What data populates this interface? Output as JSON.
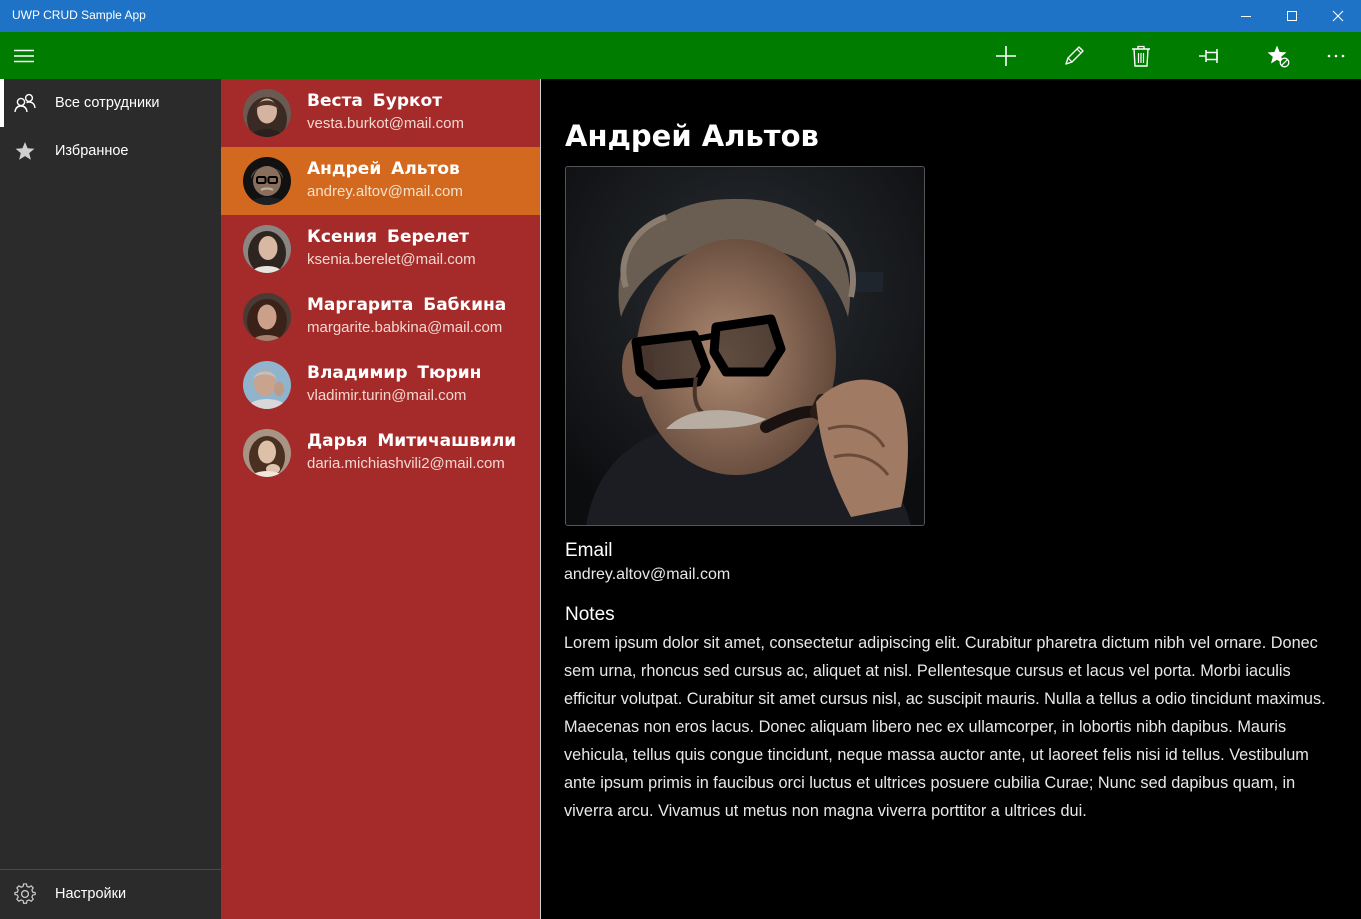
{
  "window": {
    "title": "UWP CRUD Sample App",
    "accent": "#1e73c6",
    "buttons": [
      "minimize-icon",
      "maximize-icon",
      "close-icon"
    ]
  },
  "commandbar": {
    "background": "#007c00",
    "menu_icon": "hamburger-icon",
    "actions": [
      "add-icon",
      "edit-icon",
      "delete-icon",
      "pin-icon",
      "favorite-icon",
      "more-icon"
    ]
  },
  "nav": {
    "items": [
      {
        "label": "Все сотрудники",
        "icon": "people-icon",
        "selected": true
      },
      {
        "label": "Избранное",
        "icon": "star-icon",
        "selected": false
      }
    ],
    "footer": {
      "label": "Настройки",
      "icon": "gear-icon"
    }
  },
  "contacts": [
    {
      "name": "Веста Буркот",
      "email": "vesta.burkot@mail.com"
    },
    {
      "name": "Андрей Альтов",
      "email": "andrey.altov@mail.com",
      "selected": true
    },
    {
      "name": "Ксения Берелет",
      "email": "ksenia.berelet@mail.com"
    },
    {
      "name": "Маргарита Бабкина",
      "email": "margarite.babkina@mail.com"
    },
    {
      "name": "Владимир Тюрин",
      "email": "vladimir.turin@mail.com"
    },
    {
      "name": "Дарья Митичашвили",
      "email": "daria.michiashvili2@mail.com"
    }
  ],
  "detail": {
    "name": "Андрей Альтов",
    "email_label": "Email",
    "email": "andrey.altov@mail.com",
    "notes_label": "Notes",
    "notes": "Lorem ipsum dolor sit amet, consectetur adipiscing elit. Curabitur pharetra dictum nibh vel ornare. Donec sem urna, rhoncus sed cursus ac, aliquet at nisl. Pellentesque cursus et lacus vel porta. Morbi iaculis efficitur volutpat. Curabitur sit amet cursus nisl, ac suscipit mauris. Nulla a tellus a odio tincidunt maximus. Maecenas non eros lacus. Donec aliquam libero nec ex ullamcorper, in lobortis nibh dapibus. Mauris vehicula, tellus quis congue tincidunt, neque massa auctor ante, ut laoreet felis nisi id tellus. Vestibulum ante ipsum primis in faucibus orci luctus et ultrices posuere cubilia Curae; Nunc sed dapibus quam, in viverra arcu. Vivamus ut metus non magna viverra porttitor a ultrices dui."
  },
  "colors": {
    "nav_bg": "#2b2b2b",
    "list_bg": "#a52a2a",
    "list_selected": "#d2691e",
    "detail_bg": "#000000"
  }
}
